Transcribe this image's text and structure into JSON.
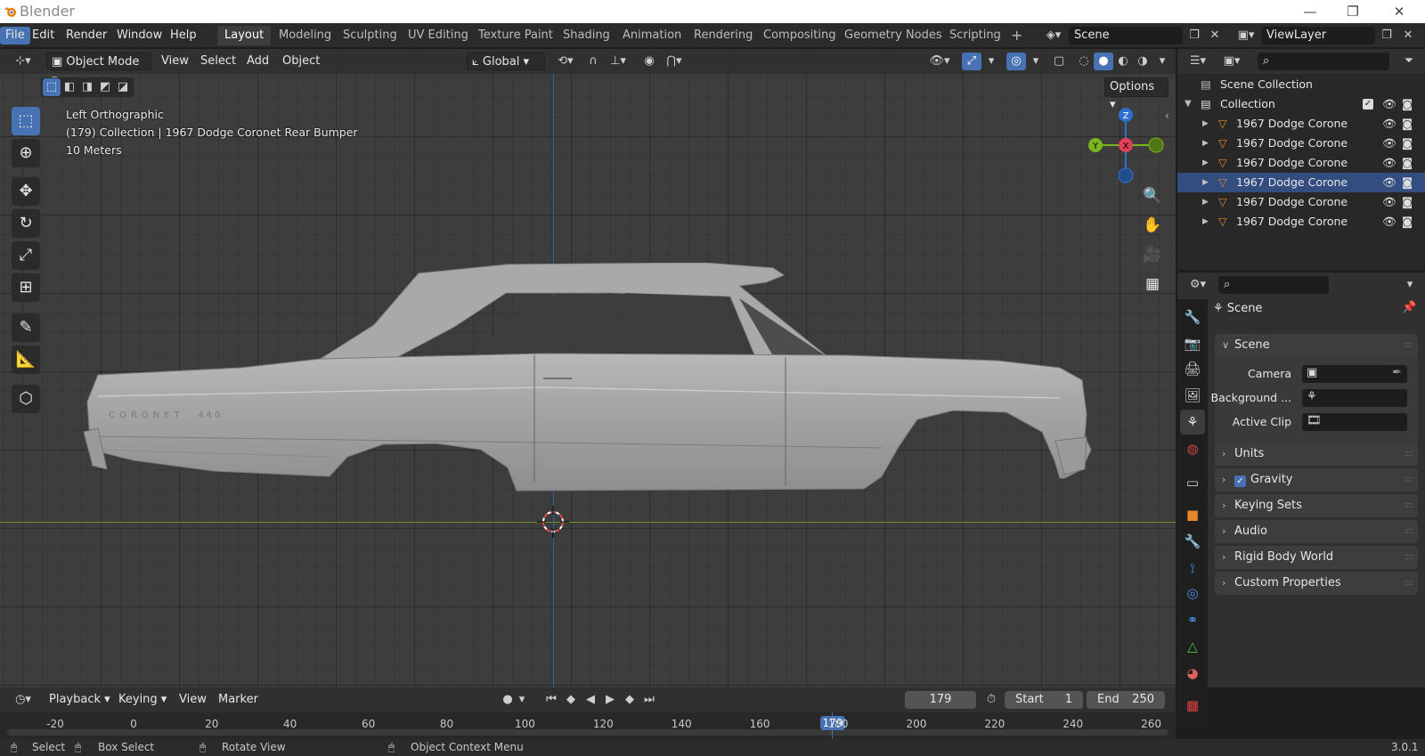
{
  "app": {
    "title": "Blender",
    "version": "3.0.1"
  },
  "window_controls": {
    "minimize": "—",
    "maximize": "❐",
    "close": "✕"
  },
  "menu": [
    "File",
    "Edit",
    "Render",
    "Window",
    "Help"
  ],
  "workspaces": [
    "Layout",
    "Modeling",
    "Sculpting",
    "UV Editing",
    "Texture Paint",
    "Shading",
    "Animation",
    "Rendering",
    "Compositing",
    "Geometry Nodes",
    "Scripting"
  ],
  "workspace_add": "+",
  "scene_name": "Scene",
  "view_layer": "ViewLayer",
  "viewport_header": {
    "mode": "Object Mode",
    "menus": [
      "View",
      "Select",
      "Add",
      "Object"
    ],
    "orientation": "Global",
    "options": "Options"
  },
  "viewport_overlay": {
    "view_name": "Left Orthographic",
    "context": "(179) Collection | 1967 Dodge Coronet Rear Bumper",
    "scale": "10 Meters"
  },
  "gizmo": {
    "z": "Z",
    "y": "Y",
    "x": "X"
  },
  "car_badges": {
    "script": "CORONET",
    "model": "440"
  },
  "outliner": {
    "root": "Scene Collection",
    "collection": "Collection",
    "objects": [
      "1967 Dodge Corone",
      "1967 Dodge Corone",
      "1967 Dodge Corone",
      "1967 Dodge Corone",
      "1967 Dodge Corone",
      "1967 Dodge Corone"
    ]
  },
  "properties": {
    "context": "Scene",
    "scene_panel": "Scene",
    "rows": [
      {
        "label": "Camera"
      },
      {
        "label": "Background ..."
      },
      {
        "label": "Active Clip"
      }
    ],
    "panels": [
      "Units",
      "Gravity",
      "Keying Sets",
      "Audio",
      "Rigid Body World",
      "Custom Properties"
    ],
    "gravity_checked": true
  },
  "timeline": {
    "menus": [
      "Playback",
      "Keying",
      "View",
      "Marker"
    ],
    "current_frame": "179",
    "start_label": "Start",
    "start": "1",
    "end_label": "End",
    "end": "250",
    "ticks": [
      "-20",
      "0",
      "20",
      "40",
      "60",
      "80",
      "100",
      "120",
      "140",
      "160",
      "180",
      "200",
      "220",
      "240",
      "260"
    ],
    "frame_marker": "179"
  },
  "status_bar": {
    "select": "Select",
    "box_select": "Box Select",
    "rotate_view": "Rotate View",
    "context_menu": "Object Context Menu",
    "version": "3.0.1"
  },
  "colors": {
    "accent": "#4772b3",
    "header": "#303030",
    "viewport": "#3d3d3d"
  }
}
